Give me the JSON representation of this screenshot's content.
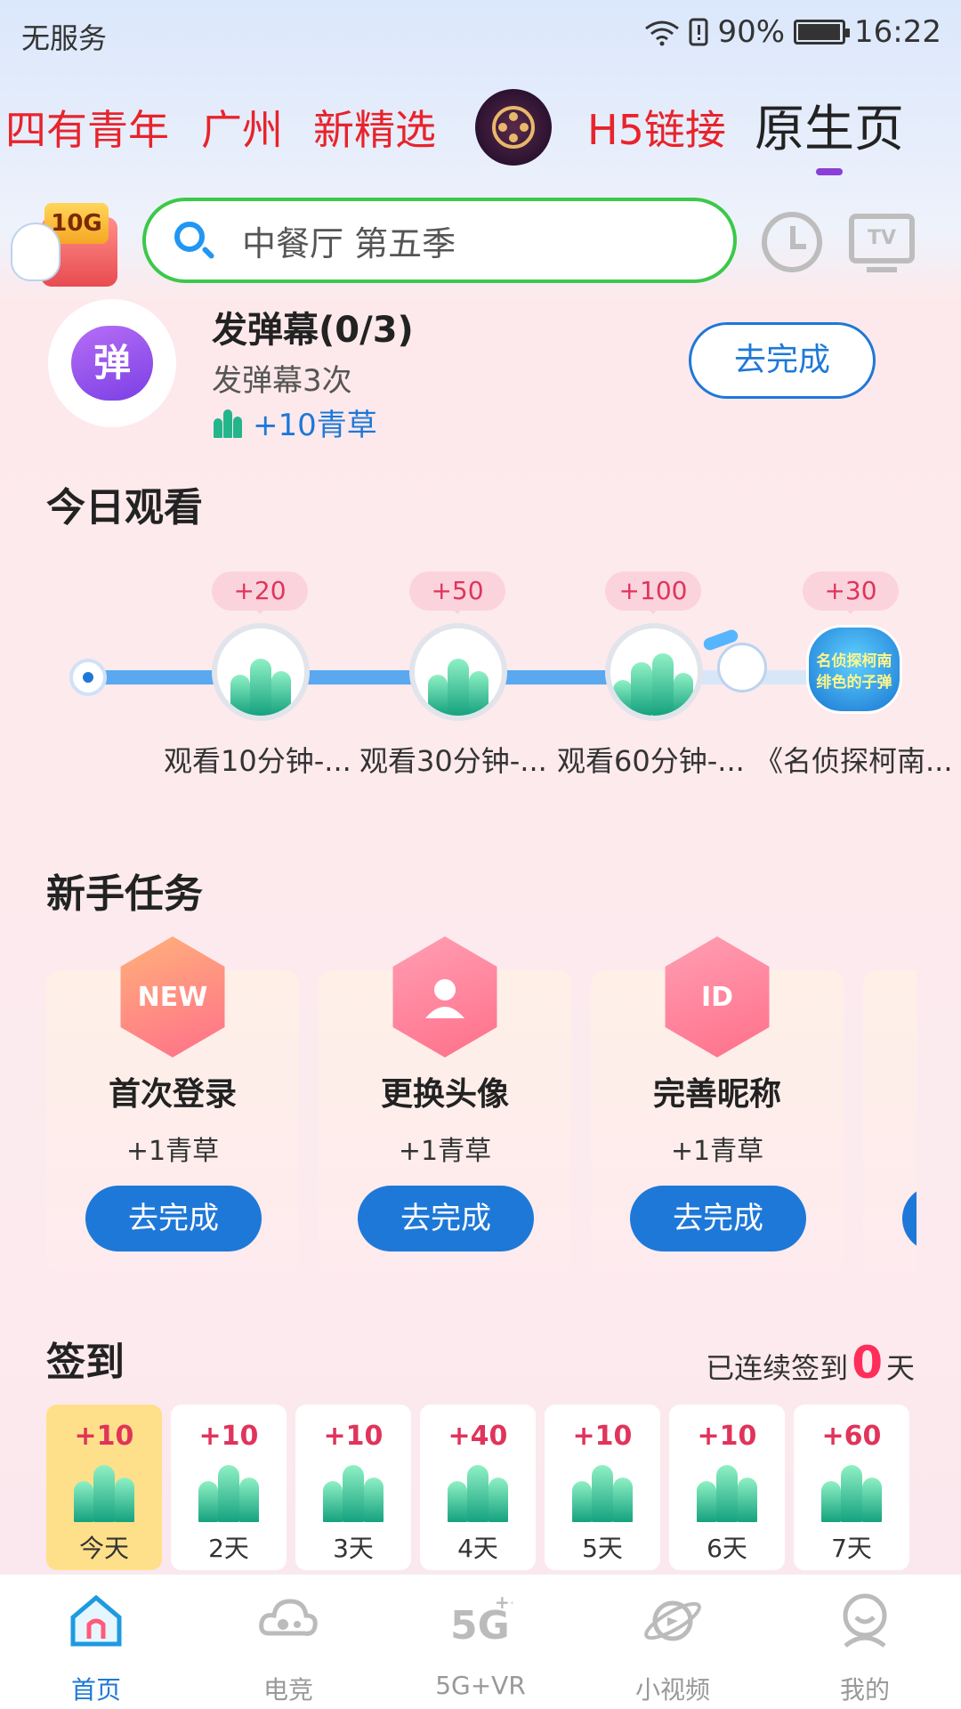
{
  "status_bar": {
    "carrier": "无服务",
    "battery": "90%",
    "battery_level": 0.9,
    "time": "16:22"
  },
  "top_nav": {
    "tabs": [
      "四有青年",
      "广州",
      "新精选",
      "H5链接",
      "原生页"
    ],
    "active_tab": "原生页"
  },
  "header": {
    "gift_badge": "10G",
    "search_placeholder": "中餐厅 第五季",
    "tv_icon_text": "TV"
  },
  "danmu_task": {
    "icon_text": "弹",
    "title": "发弹幕(0/3)",
    "subtitle": "发弹幕3次",
    "reward": "+10青草",
    "button": "去完成"
  },
  "today_watch": {
    "title": "今日观看",
    "milestones": [
      {
        "badge": "+20",
        "label": "观看10分钟-..."
      },
      {
        "badge": "+50",
        "label": "观看30分钟-..."
      },
      {
        "badge": "+100",
        "label": "观看60分钟-..."
      },
      {
        "badge": "+30",
        "label": "《名侦探柯南...",
        "poster_text": "名侦探柯南 绯色的子弹"
      }
    ]
  },
  "newbie_tasks": {
    "title": "新手任务",
    "items": [
      {
        "name": "首次登录",
        "reward": "+1青草",
        "button": "去完成",
        "icon_text": "NEW"
      },
      {
        "name": "更换头像",
        "reward": "+1青草",
        "button": "去完成",
        "icon_text": ""
      },
      {
        "name": "完善昵称",
        "reward": "+1青草",
        "button": "去完成",
        "icon_text": "ID"
      }
    ]
  },
  "sign_in": {
    "title": "签到",
    "streak_prefix": "已连续签到",
    "streak_count": "0",
    "streak_suffix": "天",
    "days": [
      {
        "plus": "+10",
        "label": "今天"
      },
      {
        "plus": "+10",
        "label": "2天"
      },
      {
        "plus": "+10",
        "label": "3天"
      },
      {
        "plus": "+40",
        "label": "4天"
      },
      {
        "plus": "+10",
        "label": "5天"
      },
      {
        "plus": "+10",
        "label": "6天"
      },
      {
        "plus": "+60",
        "label": "7天"
      }
    ]
  },
  "bottom_nav": {
    "items": [
      "首页",
      "电竞",
      "5G+VR",
      "小视频",
      "我的"
    ],
    "active": "首页"
  },
  "colors": {
    "accent": "#1e78d8",
    "tab_red": "#e8232c",
    "search_border": "#3cc84a",
    "reward_pink": "#e0345b"
  }
}
